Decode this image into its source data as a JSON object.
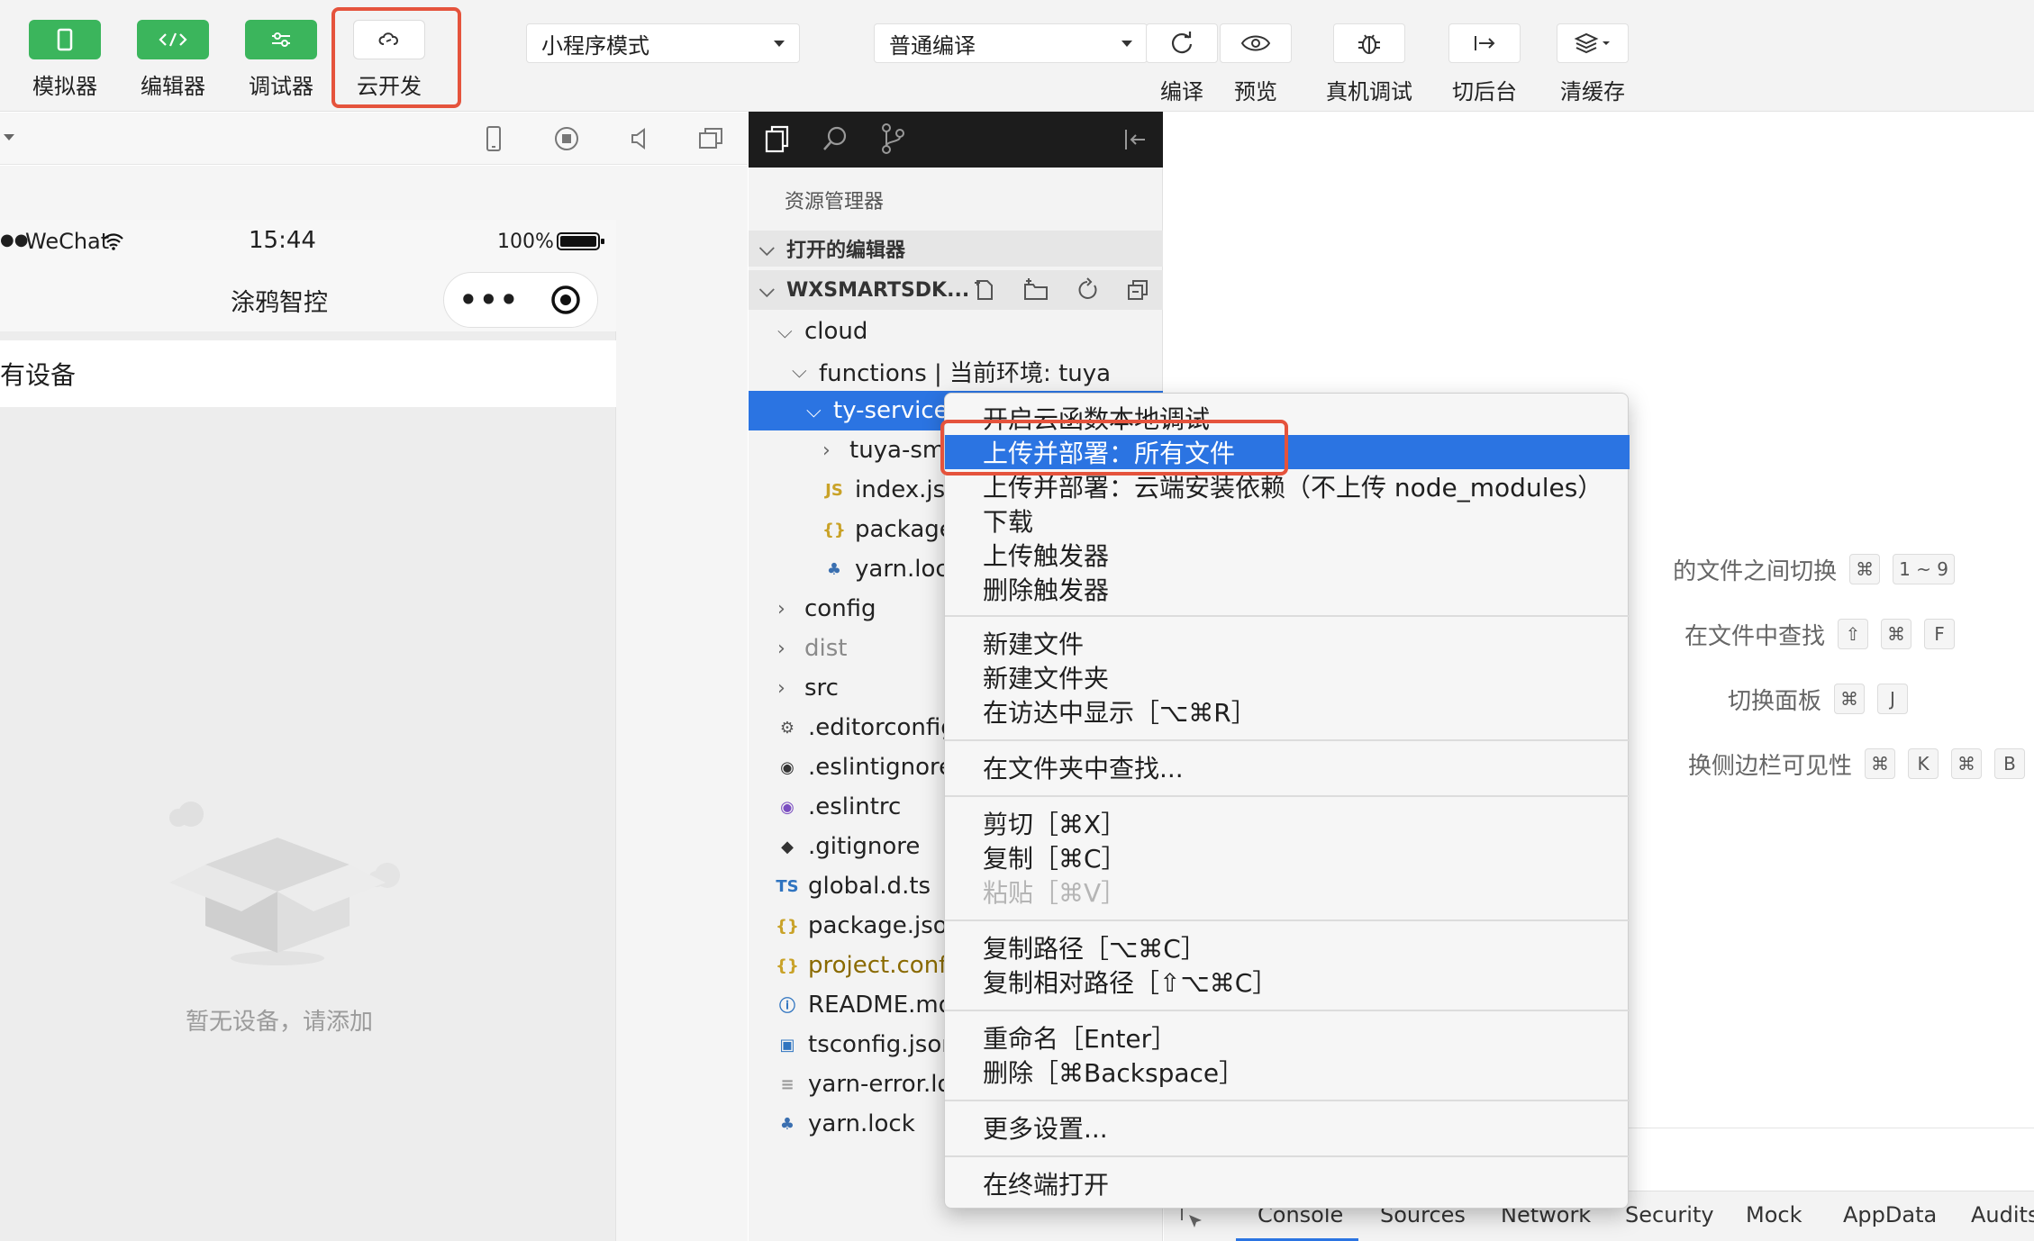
{
  "toolbar": {
    "simulator_label": "模拟器",
    "editor_label": "编辑器",
    "debugger_label": "调试器",
    "cloud_label": "云开发",
    "mode_select": "小程序模式",
    "compile_select": "普通编译",
    "compile_label": "编译",
    "preview_label": "预览",
    "real_debug_label": "真机调试",
    "background_label": "切后台",
    "clear_cache_label": "清缓存"
  },
  "phone": {
    "carrier": "WeChat",
    "time": "15:44",
    "battery": "100%",
    "nav_title": "涂鸦智控",
    "capsule_more": "•••",
    "device_header": "有设备",
    "empty_text": "暂无设备，请添加"
  },
  "explorer": {
    "title": "资源管理器",
    "open_editors": "打开的编辑器",
    "project": "WXSMARTSDK...",
    "tree": {
      "cloud": "cloud",
      "functions": "functions | 当前环境: tuya",
      "ty_service": "ty-service",
      "tuya_sm": "tuya-sm",
      "index_js": "index.js",
      "package": "package",
      "yarn_lock_inner": "yarn.lock",
      "config": "config",
      "dist": "dist",
      "src": "src",
      "editorconfig": ".editorconfig",
      "eslintignore": ".eslintignore",
      "eslintrc": ".eslintrc",
      "gitignore": ".gitignore",
      "global_d_ts": "global.d.ts",
      "package_json": "package.json",
      "project_config": "project.config",
      "readme": "README.md",
      "tsconfig": "tsconfig.json",
      "yarn_error": "yarn-error.log",
      "yarn_lock": "yarn.lock"
    }
  },
  "shortcuts": [
    {
      "label": "的文件之间切换",
      "keys": [
        "⌘",
        "1 ~ 9"
      ]
    },
    {
      "label": "在文件中查找",
      "keys": [
        "⇧",
        "⌘",
        "F"
      ]
    },
    {
      "label": "切换面板",
      "keys": [
        "⌘",
        "J"
      ]
    },
    {
      "label": "换侧边栏可见性",
      "keys": [
        "⌘",
        "K",
        "⌘",
        "B"
      ]
    }
  ],
  "devtools_tabs": {
    "console": "Console",
    "sources": "Sources",
    "network": "Network",
    "security": "Security",
    "mock": "Mock",
    "appdata": "AppData",
    "audits": "Audits"
  },
  "context_menu": {
    "local_debug": "开启云函数本地调试",
    "upload_all": "上传并部署：所有文件",
    "upload_cloud_deps": "上传并部署：云端安装依赖（不上传 node_modules）",
    "download": "下载",
    "upload_trigger": "上传触发器",
    "delete_trigger": "删除触发器",
    "new_file": "新建文件",
    "new_folder": "新建文件夹",
    "reveal_finder": "在访达中显示［⌥⌘R］",
    "find_in_folder": "在文件夹中查找...",
    "cut": "剪切［⌘X］",
    "copy": "复制［⌘C］",
    "paste": "粘贴［⌘V］",
    "copy_path": "复制路径［⌥⌘C］",
    "copy_relative_path": "复制相对路径［⇧⌥⌘C］",
    "rename": "重命名［Enter］",
    "delete": "删除［⌘Backspace］",
    "more_settings": "更多设置...",
    "open_terminal": "在终端打开"
  },
  "colors": {
    "accent_green": "#3bb55c",
    "selection_blue": "#2b74e2",
    "highlight_red": "#e5533c"
  }
}
